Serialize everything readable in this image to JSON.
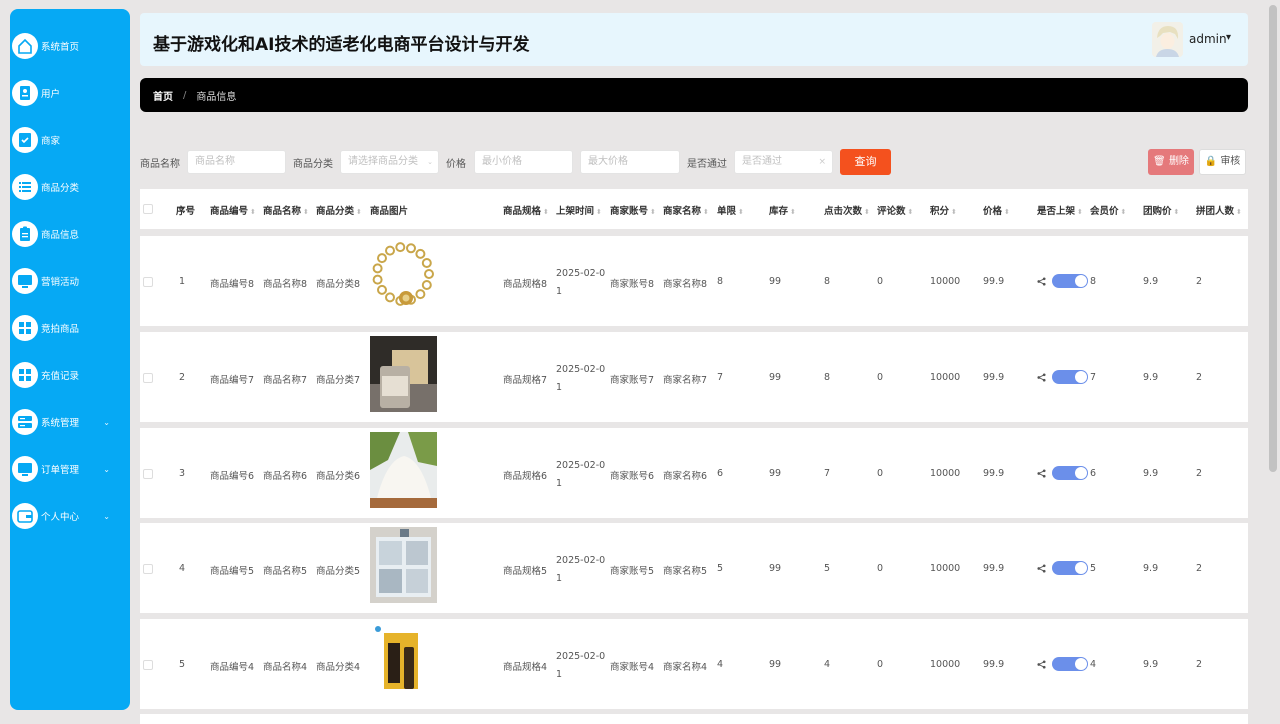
{
  "header": {
    "title": "基于游戏化和AI技术的适老化电商平台设计与开发",
    "user": "admin"
  },
  "sidebar": {
    "items": [
      {
        "label": "系统首页",
        "icon": "home-icon"
      },
      {
        "label": "用户",
        "icon": "user-doc-icon"
      },
      {
        "label": "商家",
        "icon": "merchant-check-icon"
      },
      {
        "label": "商品分类",
        "icon": "list-icon"
      },
      {
        "label": "商品信息",
        "icon": "clipboard-icon"
      },
      {
        "label": "营销活动",
        "icon": "monitor-icon"
      },
      {
        "label": "竞拍商品",
        "icon": "grid-icon"
      },
      {
        "label": "充值记录",
        "icon": "grid-icon"
      },
      {
        "label": "系统管理",
        "icon": "server-icon"
      },
      {
        "label": "订单管理",
        "icon": "monitor-icon"
      },
      {
        "label": "个人中心",
        "icon": "wallet-icon"
      }
    ]
  },
  "breadcrumb": {
    "home": "首页",
    "separator": "/",
    "current": "商品信息"
  },
  "filters": {
    "name_label": "商品名称",
    "name_placeholder": "商品名称",
    "category_label": "商品分类",
    "category_placeholder": "请选择商品分类",
    "price_label": "价格",
    "min_placeholder": "最小价格",
    "max_placeholder": "最大价格",
    "passed_label": "是否通过",
    "passed_placeholder": "是否通过",
    "search": "查询",
    "delete": "删除",
    "audit": "审核"
  },
  "table": {
    "columns": [
      "序号",
      "商品编号",
      "商品名称",
      "商品分类",
      "商品图片",
      "商品规格",
      "上架时间",
      "商家账号",
      "商家名称",
      "单限",
      "库存",
      "点击次数",
      "评论数",
      "积分",
      "价格",
      "是否上架",
      "会员价",
      "团购价",
      "拼团人数"
    ],
    "rows": [
      {
        "no": "1",
        "code": "商品编号8",
        "name": "商品名称8",
        "cat": "商品分类8",
        "spec": "商品规格8",
        "time": "2025-02-01",
        "acct": "商家账号8",
        "merchant": "商家名称8",
        "limit": "8",
        "stock": "99",
        "clicks": "8",
        "comments": "0",
        "points": "10000",
        "price": "99.9",
        "member": "8",
        "group": "9.9",
        "people": "2",
        "image": "bracelet"
      },
      {
        "no": "2",
        "code": "商品编号7",
        "name": "商品名称7",
        "cat": "商品分类7",
        "spec": "商品规格7",
        "time": "2025-02-01",
        "acct": "商家账号7",
        "merchant": "商家名称7",
        "limit": "7",
        "stock": "99",
        "clicks": "8",
        "comments": "0",
        "points": "10000",
        "price": "99.9",
        "member": "7",
        "group": "9.9",
        "people": "2",
        "image": "jar"
      },
      {
        "no": "3",
        "code": "商品编号6",
        "name": "商品名称6",
        "cat": "商品分类6",
        "spec": "商品规格6",
        "time": "2025-02-01",
        "acct": "商家账号6",
        "merchant": "商家名称6",
        "limit": "6",
        "stock": "99",
        "clicks": "7",
        "comments": "0",
        "points": "10000",
        "price": "99.9",
        "member": "6",
        "group": "9.9",
        "people": "2",
        "image": "flour"
      },
      {
        "no": "4",
        "code": "商品编号5",
        "name": "商品名称5",
        "cat": "商品分类5",
        "spec": "商品规格5",
        "time": "2025-02-01",
        "acct": "商家账号5",
        "merchant": "商家名称5",
        "limit": "5",
        "stock": "99",
        "clicks": "5",
        "comments": "0",
        "points": "10000",
        "price": "99.9",
        "member": "5",
        "group": "9.9",
        "people": "2",
        "image": "cabinet"
      },
      {
        "no": "5",
        "code": "商品编号4",
        "name": "商品名称4",
        "cat": "商品分类4",
        "spec": "商品规格4",
        "time": "2025-02-01",
        "acct": "商家账号4",
        "merchant": "商家名称4",
        "limit": "4",
        "stock": "99",
        "clicks": "4",
        "comments": "0",
        "points": "10000",
        "price": "99.9",
        "member": "4",
        "group": "9.9",
        "people": "2",
        "image": "wine"
      }
    ]
  },
  "colors": {
    "sidebar": "#06a9f4",
    "search": "#f4511e",
    "delete": "#e5797b",
    "toggle": "#6b8fea"
  }
}
